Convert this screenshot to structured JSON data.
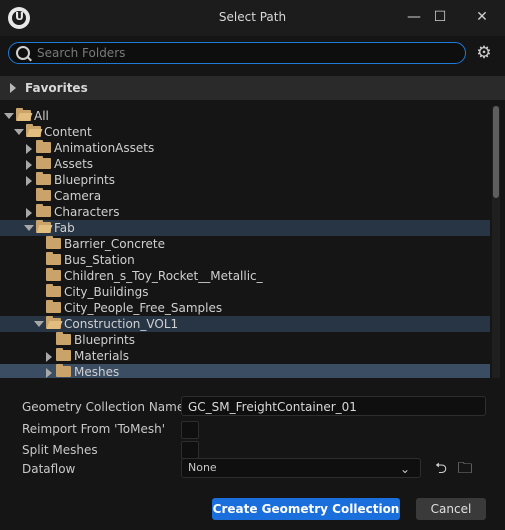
{
  "window": {
    "title": "Select Path",
    "minimize": "—",
    "maximize": "☐",
    "close": "✕"
  },
  "search": {
    "placeholder": "Search Folders"
  },
  "favorites": {
    "label": "Favorites"
  },
  "tree": [
    {
      "label": "All",
      "depth": 0,
      "expanded": true,
      "state": "normal"
    },
    {
      "label": "Content",
      "depth": 1,
      "expanded": true,
      "state": "normal"
    },
    {
      "label": "AnimationAssets",
      "depth": 2,
      "expanded": false,
      "state": "normal"
    },
    {
      "label": "Assets",
      "depth": 2,
      "expanded": false,
      "state": "normal"
    },
    {
      "label": "Blueprints",
      "depth": 2,
      "expanded": false,
      "state": "normal"
    },
    {
      "label": "Camera",
      "depth": 2,
      "expanded": null,
      "state": "normal"
    },
    {
      "label": "Characters",
      "depth": 2,
      "expanded": false,
      "state": "normal"
    },
    {
      "label": "Fab",
      "depth": 2,
      "expanded": true,
      "state": "sel"
    },
    {
      "label": "Barrier_Concrete",
      "depth": 3,
      "expanded": null,
      "state": "normal"
    },
    {
      "label": "Bus_Station",
      "depth": 3,
      "expanded": null,
      "state": "normal"
    },
    {
      "label": "Children_s_Toy_Rocket__Metallic_",
      "depth": 3,
      "expanded": null,
      "state": "normal"
    },
    {
      "label": "City_Buildings",
      "depth": 3,
      "expanded": null,
      "state": "normal"
    },
    {
      "label": "City_People_Free_Samples",
      "depth": 3,
      "expanded": null,
      "state": "normal"
    },
    {
      "label": "Construction_VOL1",
      "depth": 3,
      "expanded": true,
      "state": "sel"
    },
    {
      "label": "Blueprints",
      "depth": 4,
      "expanded": null,
      "state": "normal"
    },
    {
      "label": "Materials",
      "depth": 4,
      "expanded": false,
      "state": "normal"
    },
    {
      "label": "Meshes",
      "depth": 4,
      "expanded": false,
      "state": "hl"
    }
  ],
  "form": {
    "collection_name_label": "Geometry Collection Name",
    "collection_name_value": "GC_SM_FreightContainer_01",
    "reimport_label": "Reimport From 'ToMesh'",
    "split_label": "Split Meshes",
    "dataflow_label": "Dataflow",
    "dataflow_value": "None"
  },
  "buttons": {
    "create": "Create Geometry Collection",
    "cancel": "Cancel"
  },
  "colors": {
    "accent": "#1b6fdc",
    "folder": "#c9a36a",
    "selected_row": "#283544",
    "highlight_row": "#3b4d63"
  }
}
